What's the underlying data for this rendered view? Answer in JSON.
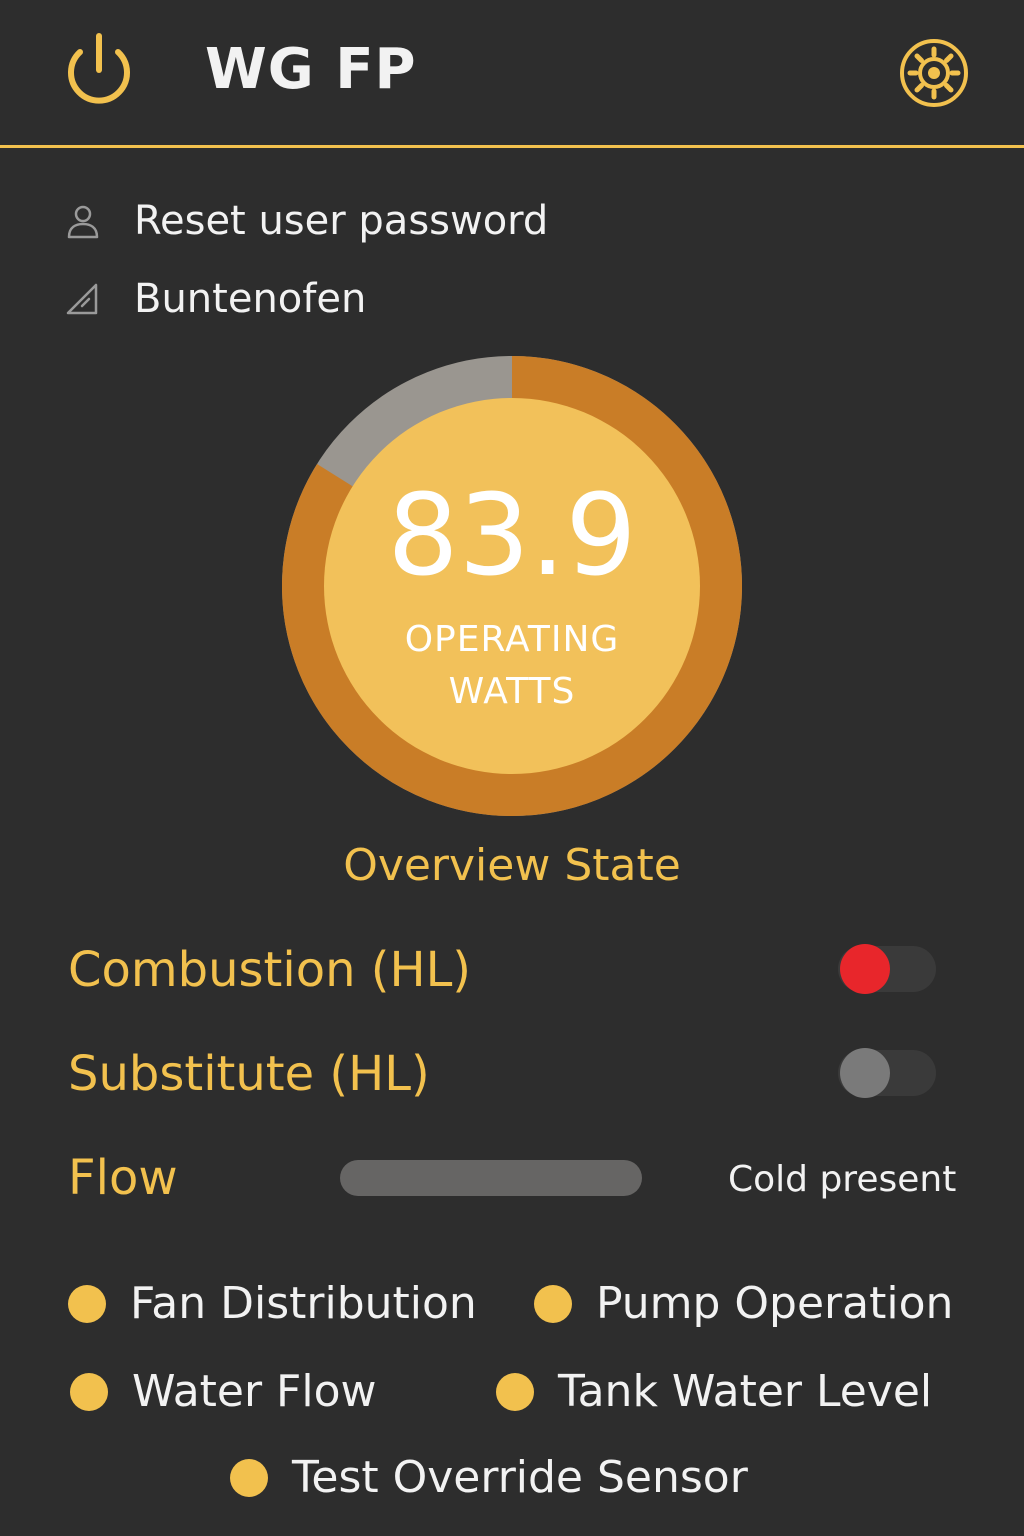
{
  "header": {
    "title": "WG FP",
    "power_icon": "power-icon",
    "settings_icon": "gear-icon"
  },
  "info": {
    "reset_label": "Reset user password",
    "reset_icon": "user-icon",
    "device_label": "Buntenofen",
    "device_icon": "triangle-ruler-icon"
  },
  "gauge": {
    "value": "83.9",
    "unit_line1": "OPERATING",
    "unit_line2": "WATTS",
    "fill_fraction": 0.839,
    "colors": {
      "track": "#9a9690",
      "fill": "#c97d27",
      "inner": "#f2c15a"
    }
  },
  "overview": {
    "title": "Overview State"
  },
  "states": {
    "combustion": {
      "label": "Combustion (HL)",
      "on": true,
      "knob_color": "#e8262b"
    },
    "substitute": {
      "label": "Substitute (HL)",
      "on": false,
      "knob_color": "#7a7a7a"
    },
    "flow": {
      "label": "Flow",
      "status": "Cold present"
    }
  },
  "legend": {
    "fan": "Fan Distribution",
    "pump": "Pump Operation",
    "water": "Water Flow",
    "tank": "Tank Water Level",
    "test": "Test Override Sensor"
  },
  "colors": {
    "background": "#2d2d2d",
    "accent": "#f2c14e",
    "text": "#f2f2f2"
  }
}
